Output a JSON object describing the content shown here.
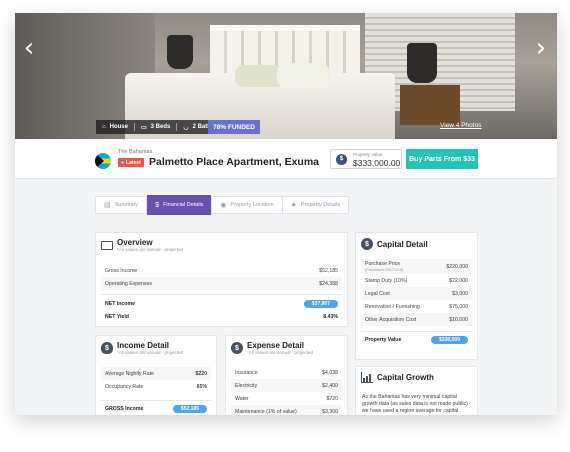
{
  "hero": {
    "features": {
      "type": "House",
      "beds": "3 Beds",
      "baths": "2 Baths"
    },
    "funded": "78% FUNDED",
    "view_photos": "View 4 Photos",
    "prev_icon": "chevron-left-icon",
    "next_icon": "chevron-right-icon"
  },
  "property": {
    "country": "The Bahamas",
    "badge": "Latest",
    "title": "Palmetto Place Apartment, Exuma",
    "value_label": "Property Value",
    "value": "$333,000.00",
    "buy_label": "Buy Parts From $33",
    "flag_colors": [
      "#00acc8",
      "#f7d11b",
      "#111111"
    ]
  },
  "tabs": [
    {
      "label": "Summary",
      "icon": "document-icon",
      "active": false
    },
    {
      "label": "Financial Details",
      "icon": "dollar-icon",
      "active": true
    },
    {
      "label": "Property Location",
      "icon": "location-pin-icon",
      "active": false
    },
    {
      "label": "Property Details",
      "icon": "star-icon",
      "active": false
    }
  ],
  "overview": {
    "title": "Overview",
    "subtitle": "*All values are annual - projected",
    "rows": [
      {
        "label": "Gross Income",
        "value": "$52,185"
      },
      {
        "label": "Operating Expenses",
        "value": "$24,388"
      }
    ],
    "net_income_label": "NET Income",
    "net_income": "$27,807",
    "net_yield_label": "NET Yield",
    "net_yield": "8.43%"
  },
  "income": {
    "title": "Income Detail",
    "subtitle": "*All values are annual - projected",
    "rows": [
      {
        "label": "Average Nightly Rate",
        "value": "$220"
      },
      {
        "label": "Occupancy Rate",
        "value": "65%"
      }
    ],
    "gross_label": "GROSS Income",
    "gross_value": "$52,185"
  },
  "expense": {
    "title": "Expense Detail",
    "subtitle": "*All values are annual - projected",
    "rows": [
      {
        "label": "Insurance",
        "value": "$4,038"
      },
      {
        "label": "Electricity",
        "value": "$2,400"
      },
      {
        "label": "Water",
        "value": "$720"
      },
      {
        "label": "Maintenance (1% of value)",
        "value": "$3,300"
      }
    ]
  },
  "capital": {
    "title": "Capital Detail",
    "rows": [
      {
        "label": "Purchase Price",
        "note": "(Purchased 2017/11/8)",
        "value": "$220,000"
      },
      {
        "label": "Stamp Duty (10%)",
        "value": "$22,000"
      },
      {
        "label": "Legal Cost",
        "value": "$3,000"
      },
      {
        "label": "Renovation / Furnishing",
        "value": "$75,000"
      },
      {
        "label": "Other Acquisition Cost",
        "value": "$10,000"
      }
    ],
    "total_label": "Property Value",
    "total_value": "$330,000"
  },
  "growth": {
    "title": "Capital Growth",
    "text": "As the Bahamas has very minimal capital growth data (as sales data is not made public) we have used a region average for capital growth"
  }
}
